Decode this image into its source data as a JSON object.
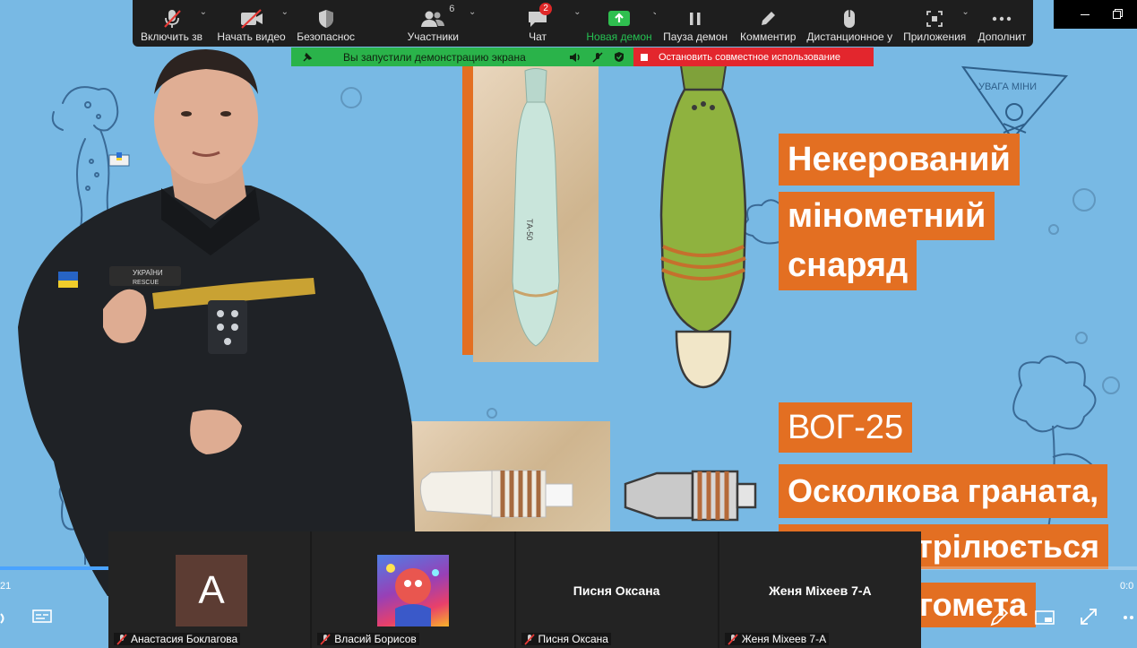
{
  "toolbar": {
    "items": [
      {
        "label": "Включить зв",
        "icon": "muted-mic-icon"
      },
      {
        "label": "Начать видео",
        "icon": "video-off-icon"
      },
      {
        "label": "Безопаснос",
        "icon": "shield-icon"
      },
      {
        "label": "Участники",
        "icon": "participants-icon",
        "count": "6"
      },
      {
        "label": "Чат",
        "icon": "chat-icon",
        "badge": "2"
      },
      {
        "label": "Новая демон",
        "icon": "share-screen-icon"
      },
      {
        "label": "Пауза демон",
        "icon": "pause-icon"
      },
      {
        "label": "Комментир",
        "icon": "annotate-icon"
      },
      {
        "label": "Дистанционное у",
        "icon": "remote-control-icon"
      },
      {
        "label": "Приложения",
        "icon": "apps-icon"
      },
      {
        "label": "Дополнит",
        "icon": "more-icon"
      }
    ]
  },
  "share_bar": {
    "text": "Вы запустили демонстрацию экрана"
  },
  "stop_bar": {
    "text": "Остановить совместное использование"
  },
  "slide": {
    "title_lines": [
      "Некерований",
      "мінометний",
      "снаряд"
    ],
    "vog_title": "ВОГ-25",
    "vog_lines": [
      "Осколкова граната,",
      "трілюється",
      "гомета"
    ],
    "sign_text": "УВАГА МІНИ",
    "patch_text": "УКРАЇНИ",
    "patch_text2": "RESCUE",
    "shell_text": "ТА-50"
  },
  "player": {
    "time_left": "21",
    "time_right": "0:0",
    "progress_pct": 9.5
  },
  "participants": [
    {
      "name": "Анастасия Боклагова",
      "avatar_letter": "A",
      "type": "letter"
    },
    {
      "name": "Власий Борисов",
      "type": "image"
    },
    {
      "name": "Писня Оксана",
      "center_name": "Писня Оксана",
      "type": "text"
    },
    {
      "name": "Женя Міхеев 7-А",
      "center_name": "Женя Міхеев 7-А",
      "type": "text"
    }
  ],
  "colors": {
    "accent_orange": "#e36f22",
    "share_green": "#2ab34a",
    "stop_red": "#e3262d",
    "background_blue": "#78b9e4"
  }
}
